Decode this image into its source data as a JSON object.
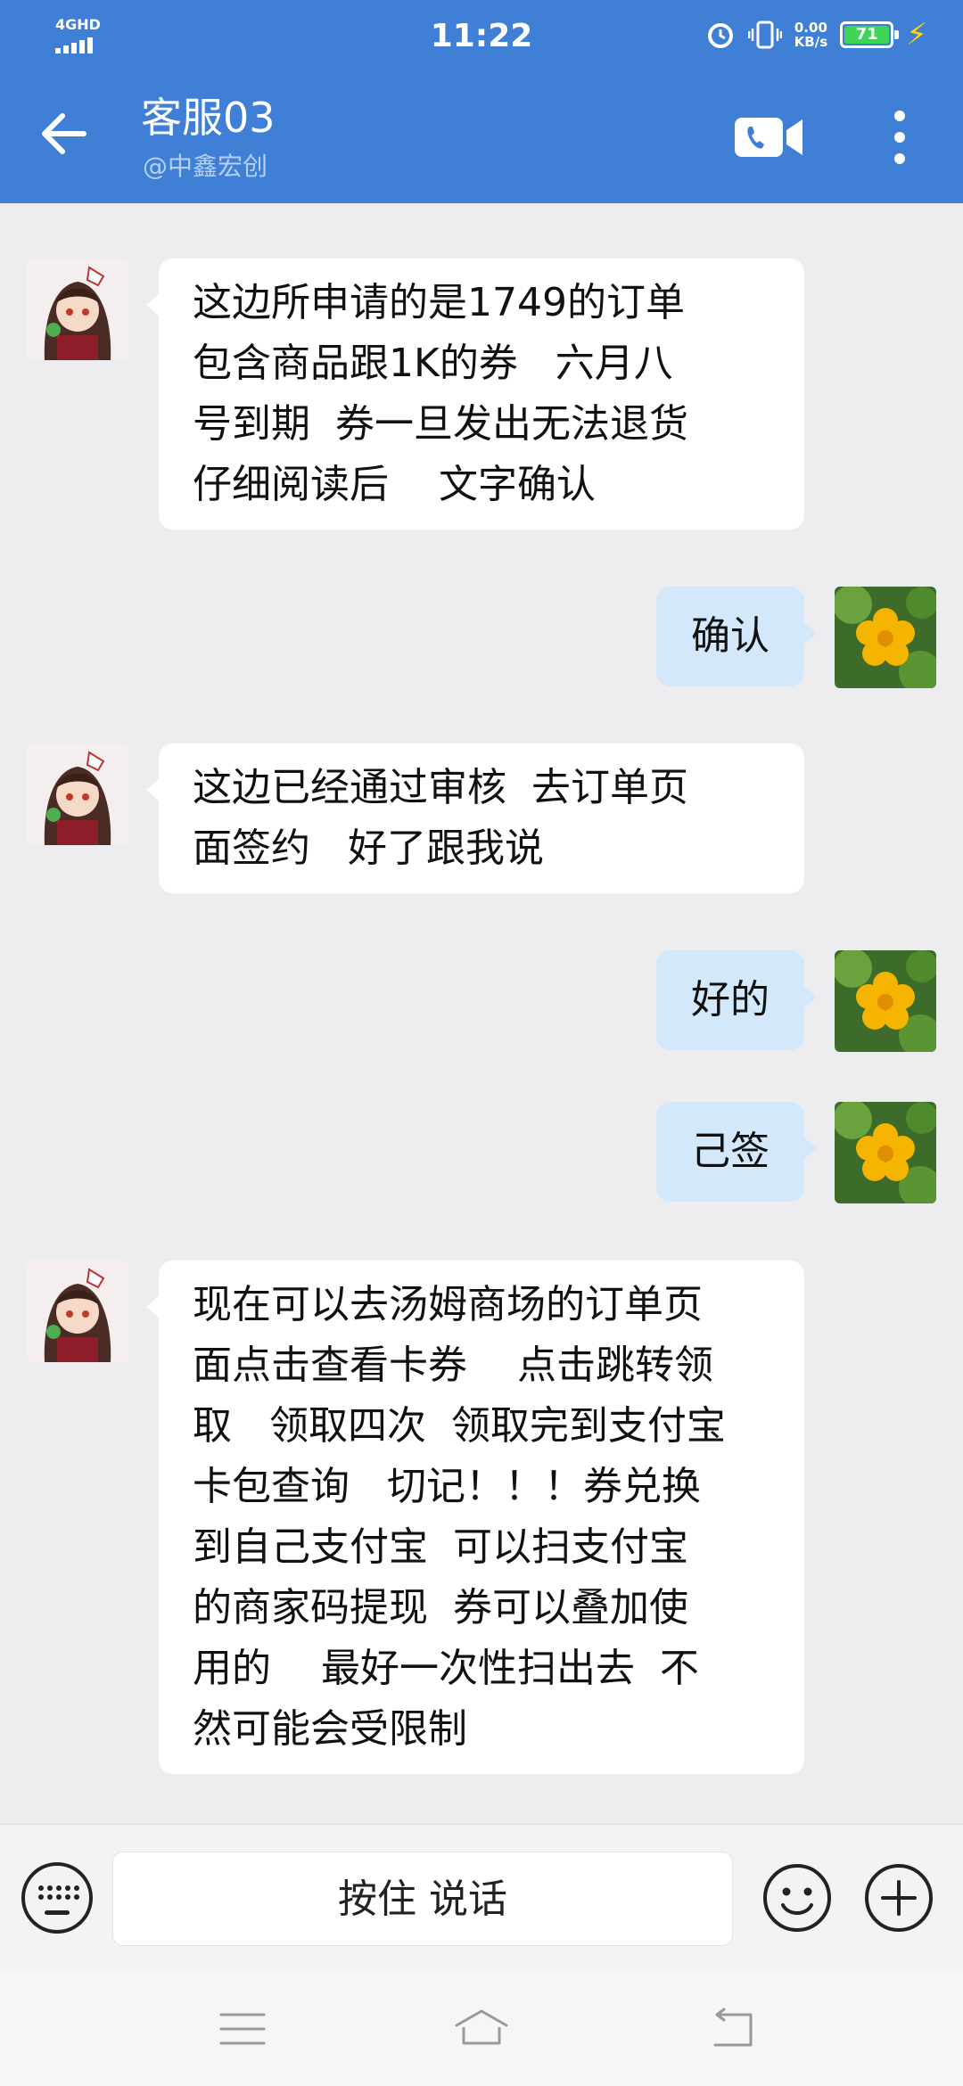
{
  "status_bar": {
    "network": "4GHD",
    "time": "11:22",
    "speed_value": "0.00",
    "speed_unit": "KB/s",
    "battery": "71",
    "battery_color": "#3fd457"
  },
  "header": {
    "title": "客服03",
    "subtitle": "@中鑫宏创",
    "background": "#3f7fd6"
  },
  "messages": [
    {
      "from": "agent",
      "lines": [
        "这边所申请的是1749的订单",
        "包含商品跟1K的券   六月八",
        "号到期  券一旦发出无法退货",
        "仔细阅读后    文字确认"
      ]
    },
    {
      "from": "me",
      "lines": [
        "确认"
      ]
    },
    {
      "from": "agent",
      "lines": [
        "这边已经通过审核  去订单页",
        "面签约   好了跟我说"
      ]
    },
    {
      "from": "me",
      "lines": [
        "好的"
      ]
    },
    {
      "from": "me",
      "lines": [
        "己签"
      ]
    },
    {
      "from": "agent",
      "lines": [
        "现在可以去汤姆商场的订单页",
        "面点击查看卡券    点击跳转领",
        "取   领取四次  领取完到支付宝",
        "卡包查询   切记！！！券兑换",
        "到自己支付宝  可以扫支付宝",
        "的商家码提现  券可以叠加使",
        "用的    最好一次性扫出去  不",
        "然可能会受限制"
      ]
    }
  ],
  "input_bar": {
    "hold_to_talk": "按住 说话"
  },
  "icons": {
    "back": "back-arrow-icon",
    "video": "video-call-icon",
    "more": "more-vertical-icon",
    "keyboard": "keyboard-icon",
    "emoji": "emoji-icon",
    "plus": "plus-icon",
    "nav_menu": "menu-icon",
    "nav_home": "home-icon",
    "nav_back": "return-icon"
  }
}
